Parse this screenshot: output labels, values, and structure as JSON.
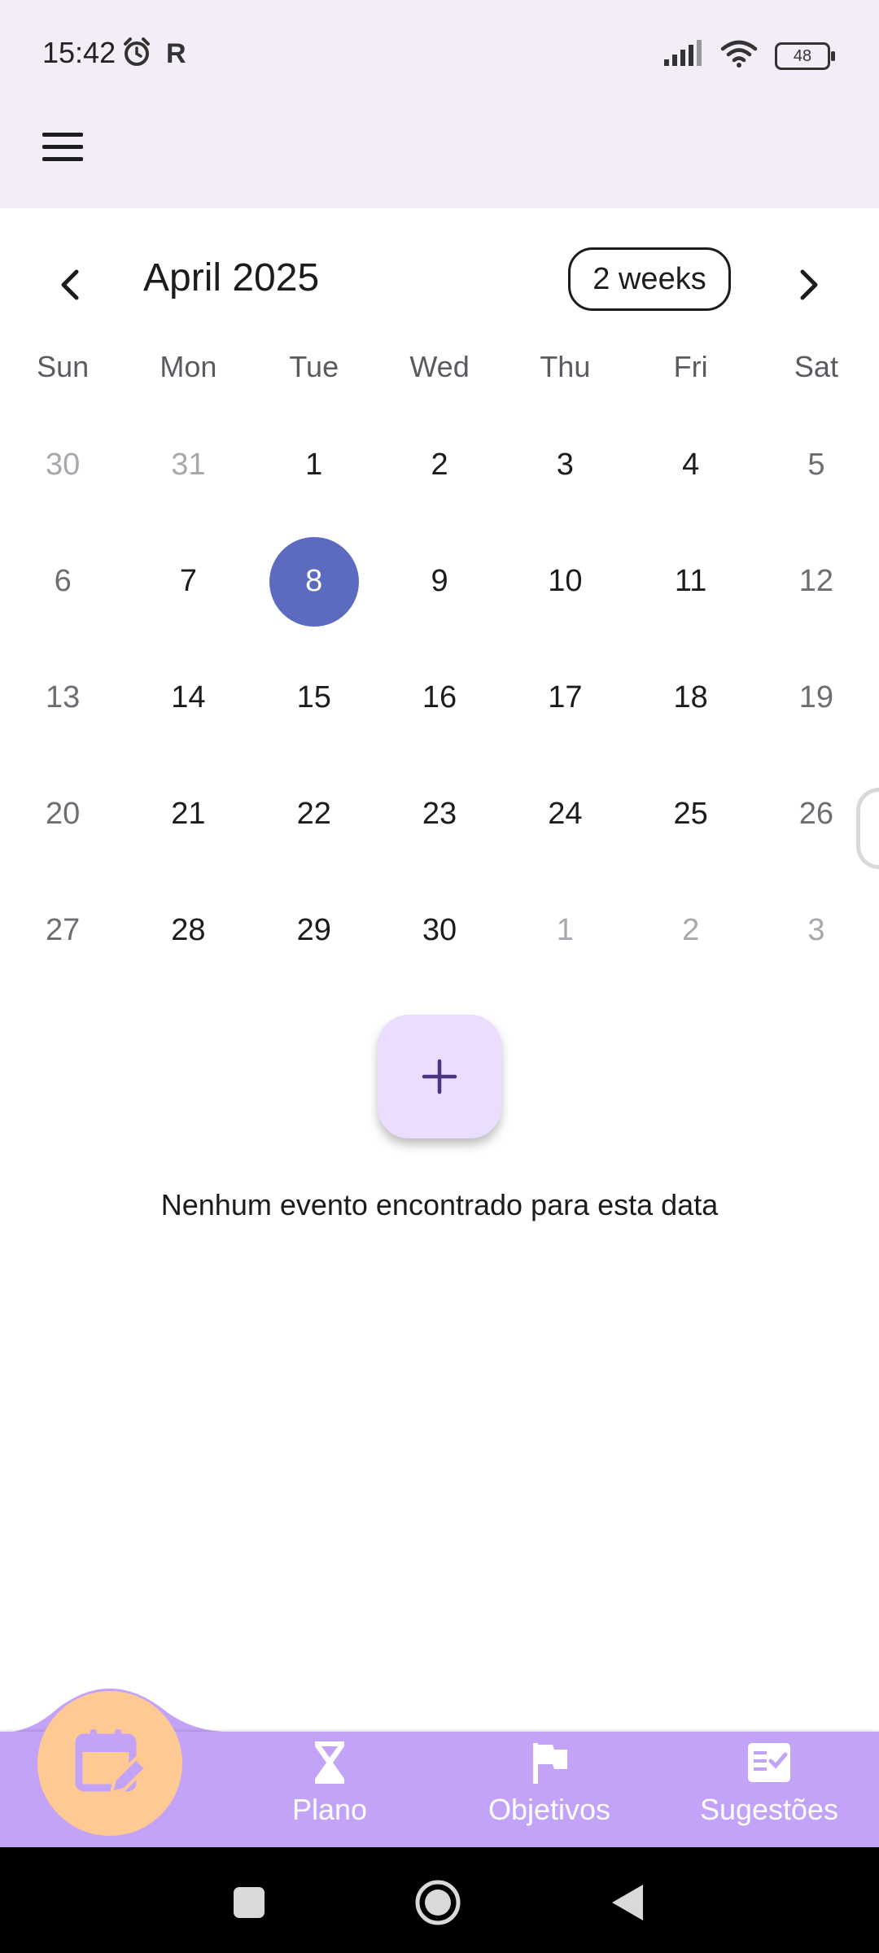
{
  "status_bar": {
    "time": "15:42",
    "carrier_glyph": "R",
    "battery": "48",
    "icons": [
      "alarm-icon",
      "signal-icon",
      "wifi-icon",
      "battery-icon"
    ]
  },
  "app_bar": {
    "menu_icon": "hamburger-menu-icon"
  },
  "calendar": {
    "month_title": "April 2025",
    "format_button": "2 weeks",
    "weekdays": [
      "Sun",
      "Mon",
      "Tue",
      "Wed",
      "Thu",
      "Fri",
      "Sat"
    ],
    "weeks": [
      [
        "30",
        "31",
        "1",
        "2",
        "3",
        "4",
        "5"
      ],
      [
        "6",
        "7",
        "8",
        "9",
        "10",
        "11",
        "12"
      ],
      [
        "13",
        "14",
        "15",
        "16",
        "17",
        "18",
        "19"
      ],
      [
        "20",
        "21",
        "22",
        "23",
        "24",
        "25",
        "26"
      ],
      [
        "27",
        "28",
        "29",
        "30",
        "1",
        "2",
        "3"
      ]
    ],
    "selected_day": "8",
    "selected_color": "#5c6bc0"
  },
  "fab": {
    "icon": "plus-icon",
    "color": "#eaddff"
  },
  "empty_message": "Nenhum evento encontrado para esta data",
  "bottom_nav": {
    "active_icon": "calendar-edit-icon",
    "active_color": "#ffc994",
    "bar_color": "#c3a3f7",
    "items": [
      {
        "label": "Plano",
        "icon": "hourglass-icon"
      },
      {
        "label": "Objetivos",
        "icon": "flag-icon"
      },
      {
        "label": "Sugestões",
        "icon": "checklist-icon"
      }
    ]
  },
  "system_nav": [
    "recents-button",
    "home-button",
    "back-button"
  ]
}
